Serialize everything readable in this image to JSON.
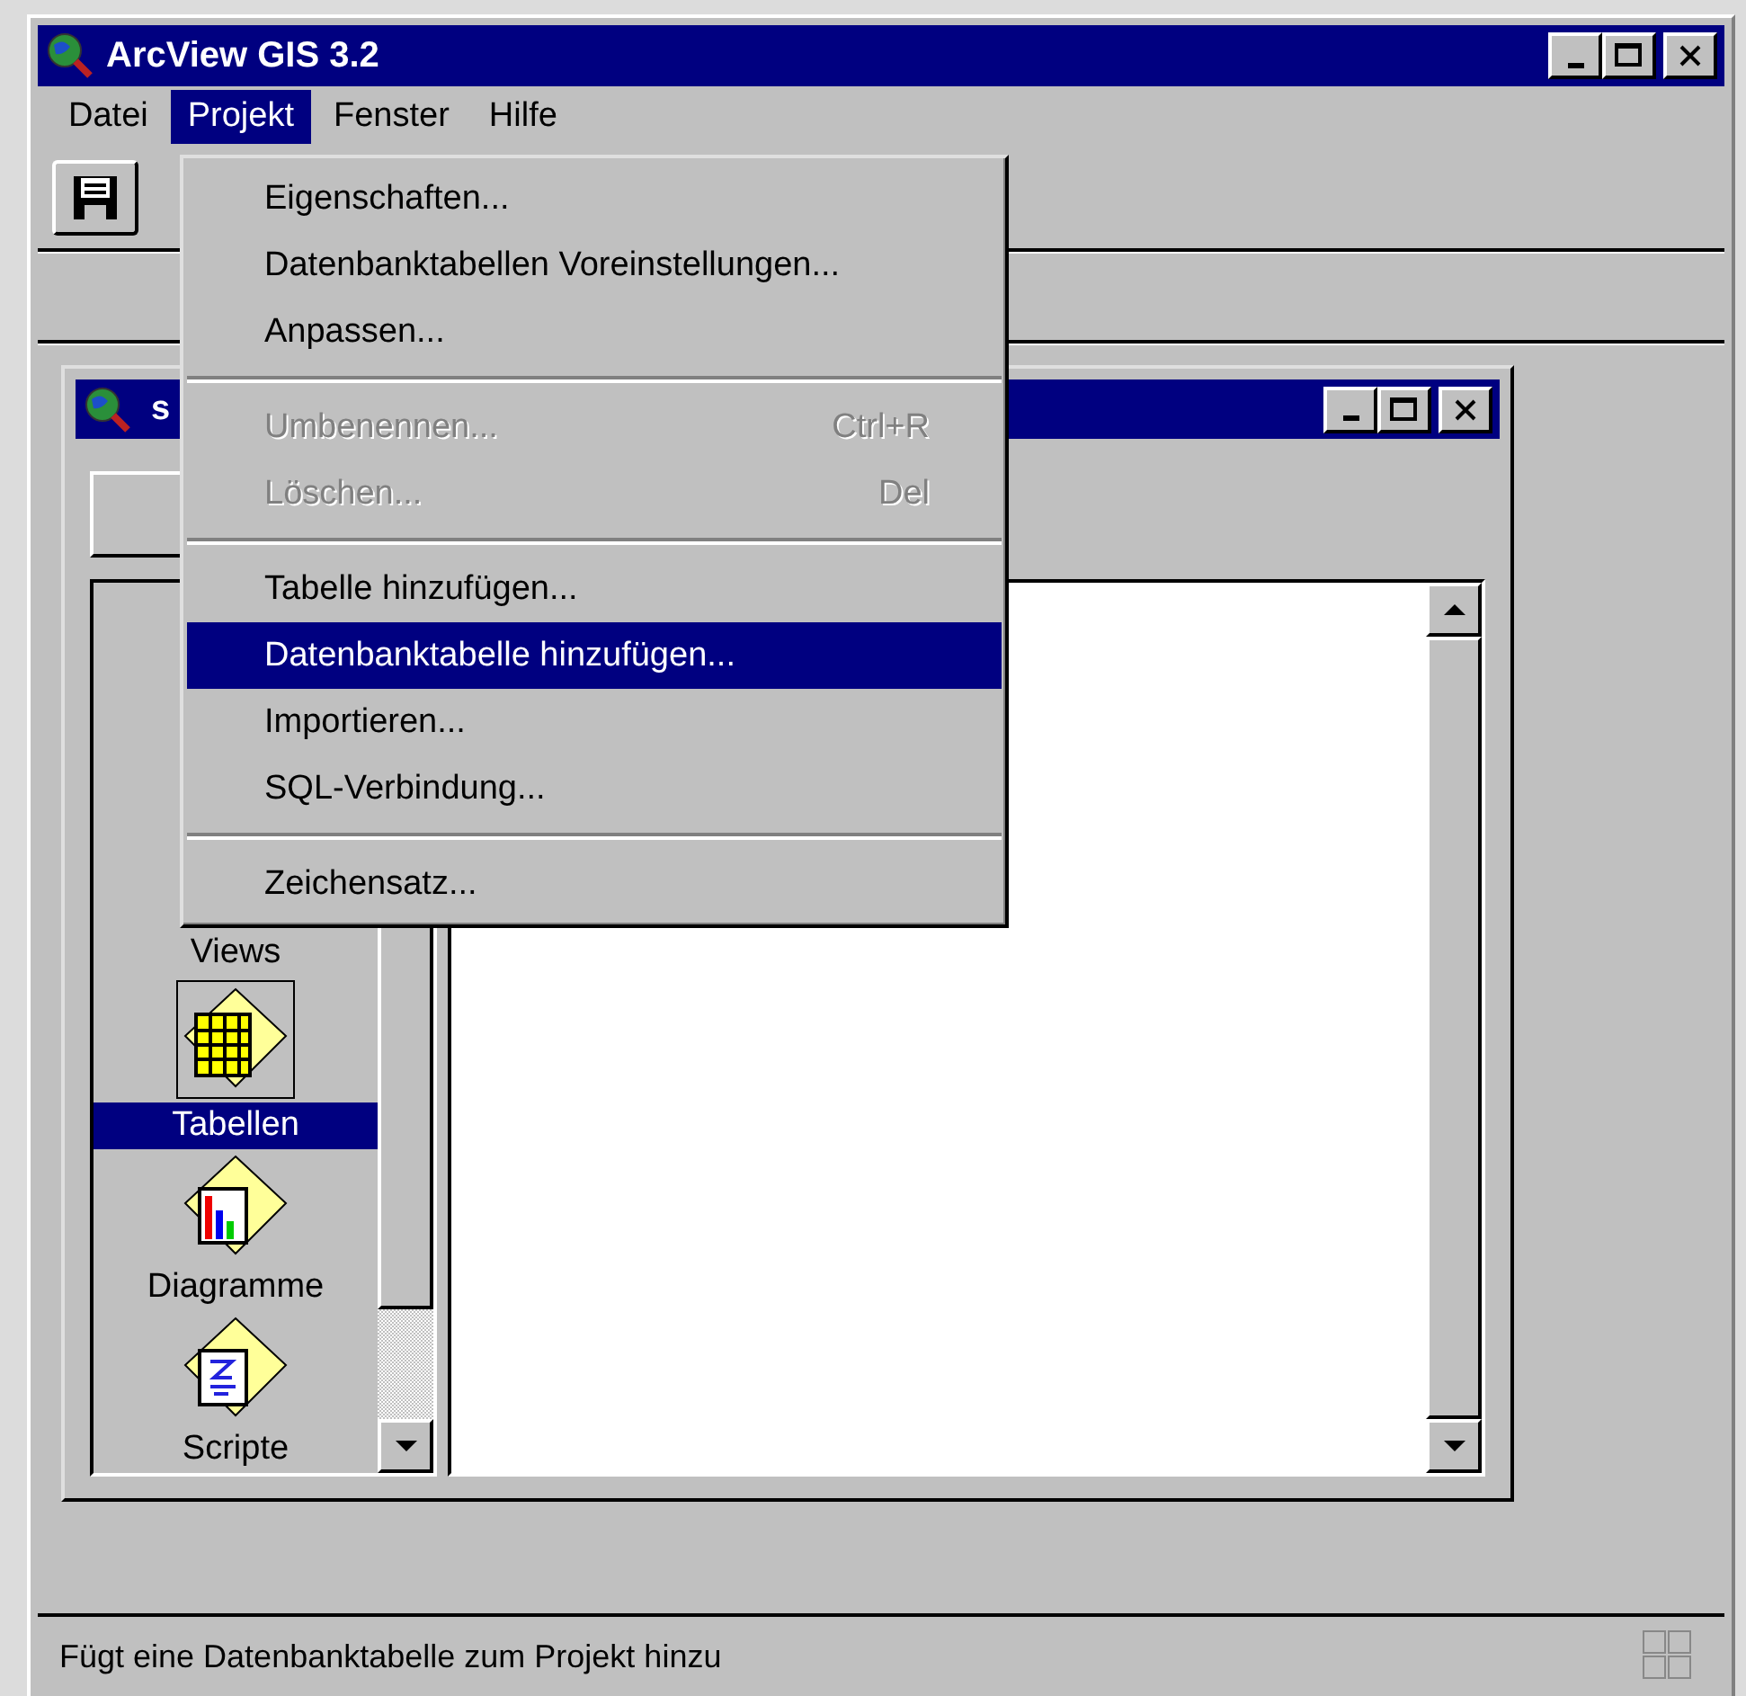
{
  "window": {
    "title": "ArcView GIS 3.2"
  },
  "menu_bar": [
    {
      "label": "Datei",
      "selected": false
    },
    {
      "label": "Projekt",
      "selected": true
    },
    {
      "label": "Fenster",
      "selected": false
    },
    {
      "label": "Hilfe",
      "selected": false
    }
  ],
  "menu": [
    {
      "kind": "item",
      "label": "Eigenschaften...",
      "disabled": false,
      "selected": false
    },
    {
      "kind": "item",
      "label": "Datenbanktabellen Voreinstellungen...",
      "disabled": false,
      "selected": false
    },
    {
      "kind": "item",
      "label": "Anpassen...",
      "disabled": false,
      "selected": false
    },
    {
      "kind": "separator"
    },
    {
      "kind": "item",
      "label": "Umbenennen...",
      "shortcut": "Ctrl+R",
      "disabled": true,
      "selected": false
    },
    {
      "kind": "item",
      "label": "Löschen...",
      "shortcut": "Del",
      "disabled": true,
      "selected": false
    },
    {
      "kind": "separator"
    },
    {
      "kind": "item",
      "label": "Tabelle hinzufügen...",
      "disabled": false,
      "selected": false
    },
    {
      "kind": "item",
      "label": "Datenbanktabelle hinzufügen...",
      "disabled": false,
      "selected": true
    },
    {
      "kind": "item",
      "label": "Importieren...",
      "disabled": false,
      "selected": false
    },
    {
      "kind": "item",
      "label": "SQL-Verbindung...",
      "disabled": false,
      "selected": false
    },
    {
      "kind": "separator"
    },
    {
      "kind": "item",
      "label": "Zeichensatz...",
      "disabled": false,
      "selected": false
    }
  ],
  "project_window": {
    "title": "s",
    "sidebar": [
      {
        "kind": "hidden",
        "label": "Views",
        "selected": false
      },
      {
        "kind": "table",
        "label": "Tabellen",
        "selected": true
      },
      {
        "kind": "chart",
        "label": "Diagramme",
        "selected": false
      },
      {
        "kind": "script",
        "label": "Scripte",
        "selected": false
      }
    ]
  },
  "status_bar": {
    "text": "Fügt eine Datenbanktabelle zum Projekt hinzu"
  }
}
